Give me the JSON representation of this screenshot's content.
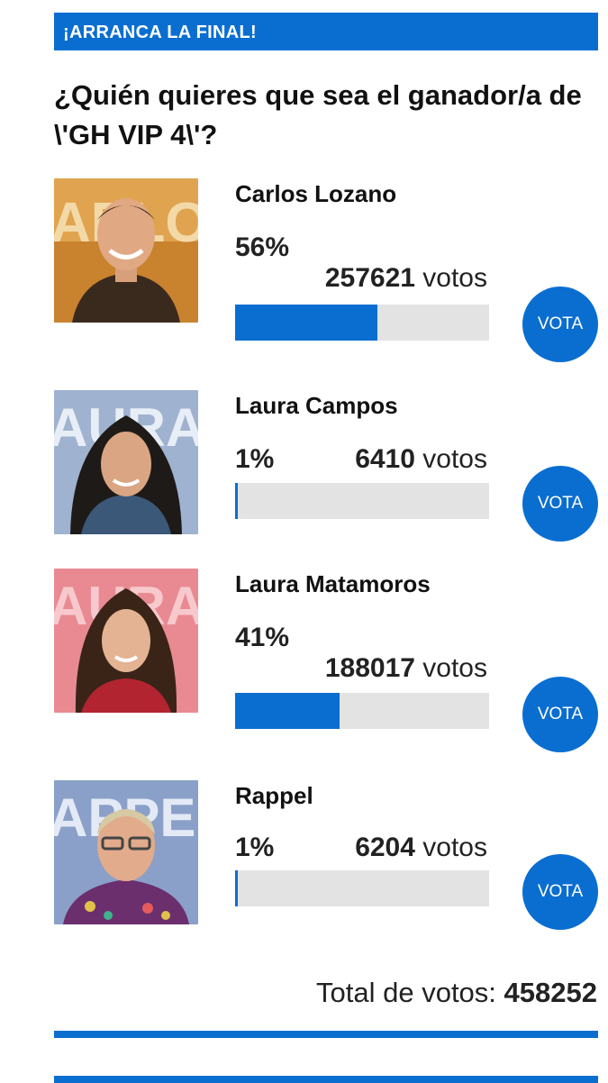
{
  "banner": "¡ARRANCA LA FINAL!",
  "question": "¿Quién quieres que sea el ganador/a de \\'GH VIP 4\\'?",
  "accent_color": "#0a6ed1",
  "candidates": [
    {
      "name": "Carlos Lozano",
      "percent": "56%",
      "votes": "257621",
      "votes_word": "votos",
      "share": 0.56,
      "button": "VOTA",
      "photo_icon": "candidate-photo-carlos-lozano"
    },
    {
      "name": "Laura Campos",
      "percent": "1%",
      "votes": "6410",
      "votes_word": "votos",
      "share": 0.01,
      "button": "VOTA",
      "photo_icon": "candidate-photo-laura-campos"
    },
    {
      "name": "Laura Matamoros",
      "percent": "41%",
      "votes": "188017",
      "votes_word": "votos",
      "share": 0.41,
      "button": "VOTA",
      "photo_icon": "candidate-photo-laura-matamoros"
    },
    {
      "name": "Rappel",
      "percent": "1%",
      "votes": "6204",
      "votes_word": "votos",
      "share": 0.01,
      "button": "VOTA",
      "photo_icon": "candidate-photo-rappel"
    }
  ],
  "total": {
    "label": "Total de votos:",
    "value": "458252"
  }
}
